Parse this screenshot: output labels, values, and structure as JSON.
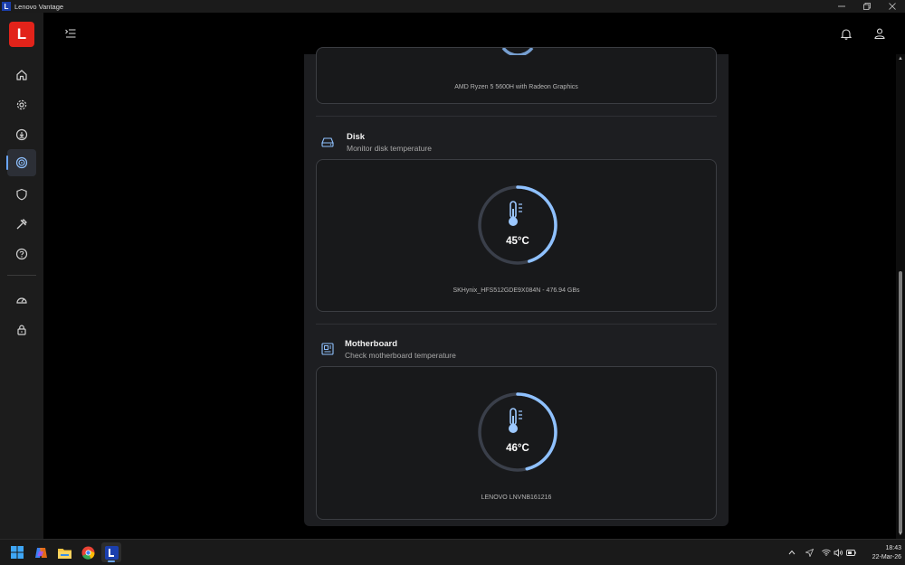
{
  "window": {
    "title": "Lenovo Vantage",
    "badge": "L",
    "minimize_icon": "minimize-icon",
    "restore_icon": "restore-icon",
    "close_icon": "close-icon"
  },
  "rail": {
    "logo_letter": "L",
    "items": [
      {
        "icon": "home-icon"
      },
      {
        "icon": "gear-icon"
      },
      {
        "icon": "download-icon"
      },
      {
        "icon": "device-health-icon",
        "active": true
      },
      {
        "icon": "shield-icon"
      },
      {
        "icon": "tools-icon"
      },
      {
        "icon": "help-icon"
      },
      {
        "icon": "speedometer-icon"
      },
      {
        "icon": "lock-icon"
      }
    ],
    "accent_color": "#6aa6ff",
    "logo_color": "#e2231a"
  },
  "header": {
    "menu_icon": "menu-collapse-icon",
    "bell_icon": "bell-icon",
    "account_icon": "account-icon"
  },
  "sections": {
    "cpu": {
      "caption": "AMD Ryzen 5 5600H with Radeon Graphics"
    },
    "disk": {
      "icon": "disk-icon",
      "title": "Disk",
      "subtitle": "Monitor disk temperature",
      "temperature": "45°C",
      "gauge_fraction": 0.45,
      "caption": "SKHynix_HFS512GDE9X084N - 476.94 GBs"
    },
    "motherboard": {
      "icon": "motherboard-icon",
      "title": "Motherboard",
      "subtitle": "Check motherboard temperature",
      "temperature": "46°C",
      "gauge_fraction": 0.46,
      "caption": "LENOVO LNVNB161216"
    }
  },
  "gauge_colors": {
    "fill": "#8fc1ff",
    "track": "#3a3f4a",
    "icon": "#9cc8ff"
  },
  "taskbar": {
    "apps": [
      {
        "icon": "windows-start-icon"
      },
      {
        "icon": "copilot-icon"
      },
      {
        "icon": "file-explorer-icon"
      },
      {
        "icon": "chrome-icon"
      },
      {
        "icon": "lenovo-vantage-icon",
        "active": true
      }
    ],
    "tray": [
      "chevron-up-icon",
      "location-icon",
      "wifi-icon",
      "volume-icon",
      "battery-icon"
    ],
    "time": "18:43",
    "date": "22-Mar-26"
  }
}
